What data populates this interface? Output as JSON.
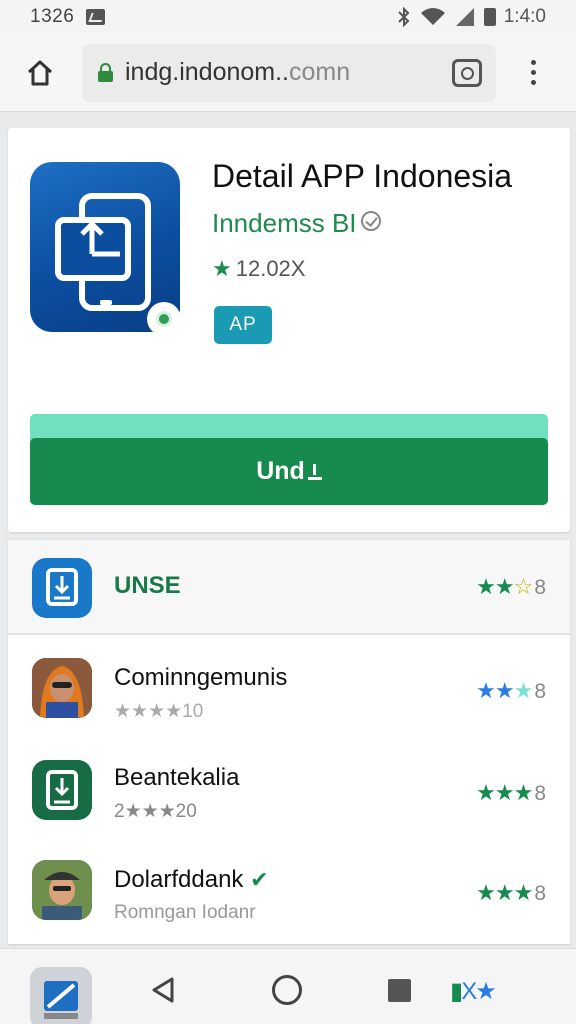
{
  "status_bar": {
    "time": "1326",
    "clock": "1:4:0",
    "icons": [
      "image-icon",
      "bluetooth-icon",
      "wifi-icon",
      "signal-icon",
      "battery-icon"
    ]
  },
  "browser": {
    "url_main": "indg.indonom..",
    "url_dim": "comn",
    "icons": [
      "home-icon",
      "lock-icon",
      "camera-icon",
      "more-vert-icon"
    ]
  },
  "app": {
    "title": "Detail APP Indonesia",
    "developer": "Inndemss BI",
    "rating_text": "12.02X",
    "tag": "AP",
    "install_label": "Und",
    "colors": {
      "primary": "#168a4f",
      "accent": "#1f8a4e",
      "icon_blue": "#0b4ea0",
      "tag": "#1a9ab3"
    }
  },
  "list": {
    "header": {
      "name": "UNSE",
      "stars": "★★",
      "half": "☆",
      "num": "8"
    },
    "items": [
      {
        "name": "Cominngemunis",
        "sub": "★★★★10",
        "stars": "★★",
        "half": "★",
        "num": "8",
        "star_color": "#2a7de1",
        "avatar": "person-orange-hood-avatar"
      },
      {
        "name": "Beantekalia",
        "sub": "2★★★20",
        "stars": "★★★",
        "half": "",
        "num": "8",
        "star_color": "#168a4f",
        "avatar": "download-app-icon"
      },
      {
        "name": "Dolarfddank",
        "sub": "Romngan Iodanr",
        "stars": "★★★",
        "half": "",
        "num": "8",
        "star_color": "#168a4f",
        "avatar": "person-hat-avatar"
      }
    ]
  },
  "nav": {
    "tray_text": "X★"
  }
}
